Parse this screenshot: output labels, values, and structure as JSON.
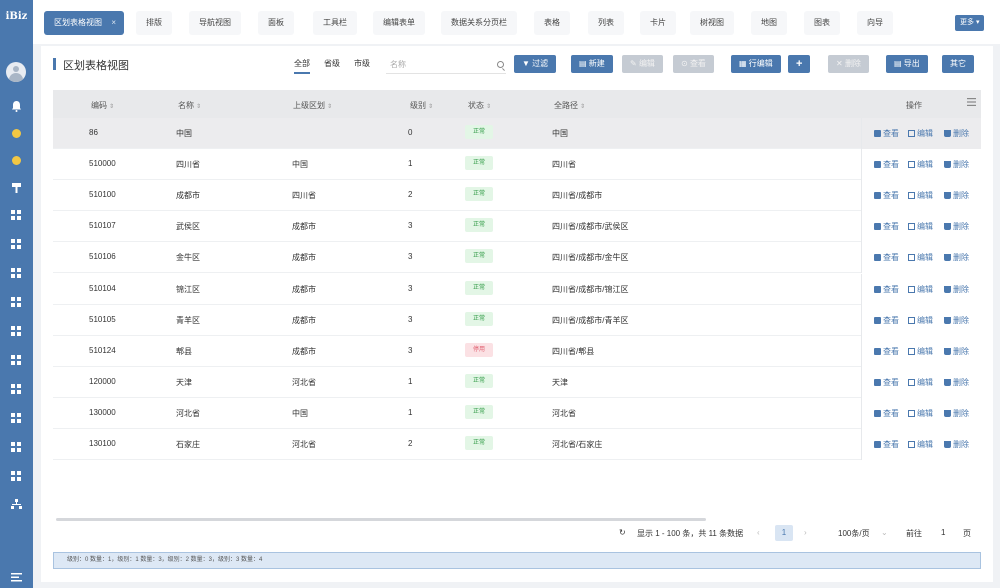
{
  "app": {
    "logo": "iBiz"
  },
  "colors": {
    "brand": "#4a78ae",
    "ok_bg": "#e3f6e6",
    "ok_text": "#2f9a45",
    "stop_bg": "#fbe1e4",
    "stop_text": "#e05c6c"
  },
  "sidebar": {
    "icons": [
      "user-avatar",
      "bell-icon",
      "gear-icon",
      "help-icon",
      "paint-roller-icon",
      "grid-icon",
      "grid-icon",
      "grid-icon",
      "grid-icon",
      "grid-icon",
      "grid-icon",
      "grid-icon",
      "grid-icon",
      "grid-icon",
      "grid-icon",
      "sitemap-icon",
      "menu-icon"
    ]
  },
  "tabs": [
    {
      "label": "区划表格视图",
      "active": true,
      "close": "×"
    },
    {
      "label": "排版"
    },
    {
      "label": "导航视图"
    },
    {
      "label": "面板"
    },
    {
      "label": "工具栏"
    },
    {
      "label": "编辑表单"
    },
    {
      "label": "数据关系分页栏"
    },
    {
      "label": "表格"
    },
    {
      "label": "列表"
    },
    {
      "label": "卡片"
    },
    {
      "label": "树视图"
    },
    {
      "label": "地图"
    },
    {
      "label": "图表"
    },
    {
      "label": "向导"
    }
  ],
  "more_label": "更多",
  "page": {
    "title": "区划表格视图"
  },
  "quick_tabs": [
    "全部",
    "省级",
    "市级"
  ],
  "search": {
    "placeholder": "名称"
  },
  "toolbar": {
    "filter": "过滤",
    "new": "新建",
    "edit": "编辑",
    "view": "查看",
    "row_edit": "行编辑",
    "add": "+",
    "delete": "删除",
    "export": "导出",
    "other": "其它"
  },
  "table": {
    "columns": [
      "编码",
      "名称",
      "上级区划",
      "级别",
      "状态",
      "全路径",
      "操作"
    ],
    "sort_glyph": "⇕",
    "rows": [
      {
        "code": "86",
        "name": "中国",
        "parent": "",
        "level": "0",
        "status": "正常",
        "path": "中国"
      },
      {
        "code": "510000",
        "name": "四川省",
        "parent": "中国",
        "level": "1",
        "status": "正常",
        "path": "四川省"
      },
      {
        "code": "510100",
        "name": "成都市",
        "parent": "四川省",
        "level": "2",
        "status": "正常",
        "path": "四川省/成都市"
      },
      {
        "code": "510107",
        "name": "武侯区",
        "parent": "成都市",
        "level": "3",
        "status": "正常",
        "path": "四川省/成都市/武侯区"
      },
      {
        "code": "510106",
        "name": "金牛区",
        "parent": "成都市",
        "level": "3",
        "status": "正常",
        "path": "四川省/成都市/金牛区"
      },
      {
        "code": "510104",
        "name": "锦江区",
        "parent": "成都市",
        "level": "3",
        "status": "正常",
        "path": "四川省/成都市/锦江区"
      },
      {
        "code": "510105",
        "name": "青羊区",
        "parent": "成都市",
        "level": "3",
        "status": "正常",
        "path": "四川省/成都市/青羊区"
      },
      {
        "code": "510124",
        "name": "郫县",
        "parent": "成都市",
        "level": "3",
        "status": "停用",
        "path": "四川省/郫县"
      },
      {
        "code": "120000",
        "name": "天津",
        "parent": "河北省",
        "level": "1",
        "status": "正常",
        "path": "天津"
      },
      {
        "code": "130000",
        "name": "河北省",
        "parent": "中国",
        "level": "1",
        "status": "正常",
        "path": "河北省"
      },
      {
        "code": "130100",
        "name": "石家庄",
        "parent": "河北省",
        "level": "2",
        "status": "正常",
        "path": "河北省/石家庄"
      }
    ],
    "row_actions": [
      "查看",
      "编辑",
      "删除"
    ]
  },
  "pagination": {
    "summary": "显示 1 - 100 条，共 11 条数据",
    "current_page": "1",
    "page_size": "100条/页",
    "goto_label": "前往",
    "goto_value": "1",
    "page_suffix": "页",
    "prev": "‹",
    "next": "›",
    "refresh": "↻",
    "dropdown": "⌄"
  },
  "footer": {
    "summary": "级别：0 数量：1，级别：1 数量：3，级别：2 数量：3，级别：3 数量：4"
  }
}
